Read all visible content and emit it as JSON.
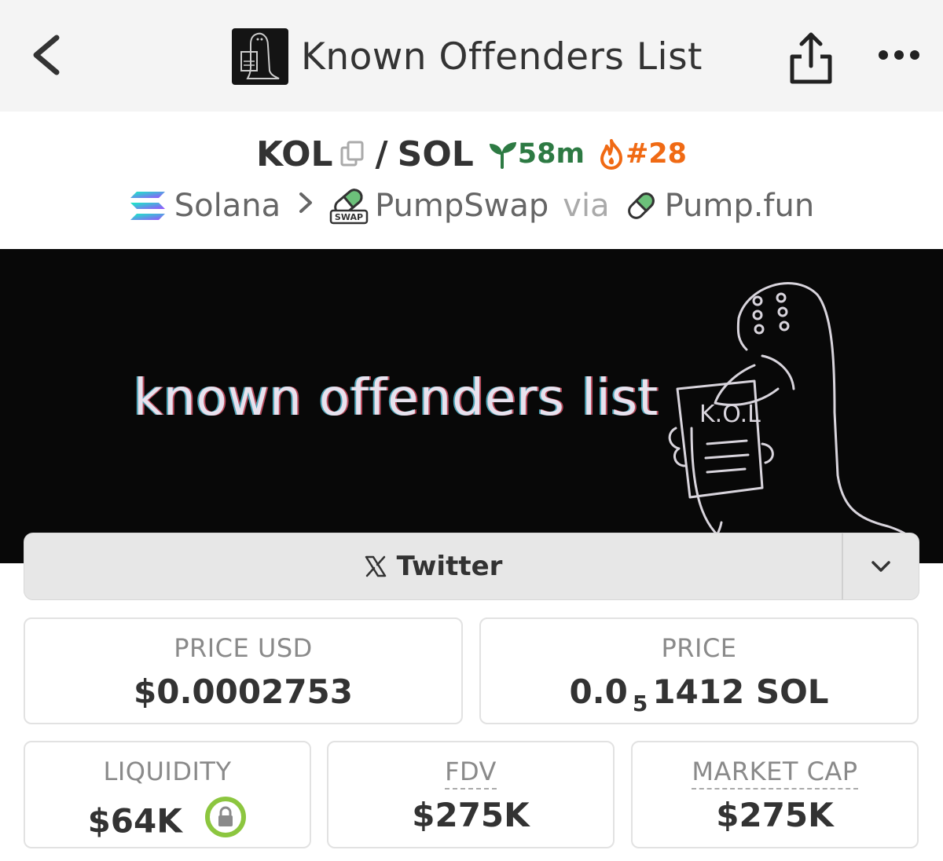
{
  "header": {
    "title": "Known Offenders List",
    "avatar_text": "K.O.L"
  },
  "pair": {
    "base": "KOL",
    "separator": "/",
    "quote": "SOL",
    "age": "58m",
    "rank": "#28"
  },
  "chain": {
    "network": "Solana",
    "dex": "PumpSwap",
    "via": "via",
    "launchpad": "Pump.fun",
    "swap_badge": "SWAP"
  },
  "banner": {
    "text": "known offenders list",
    "sign_text": "K.O.L"
  },
  "social": {
    "label": "Twitter"
  },
  "stats": {
    "price_usd_label": "PRICE USD",
    "price_usd_value": "$0.0002753",
    "price_label": "PRICE",
    "price_prefix": "0.0",
    "price_zeros": "5",
    "price_digits": "1412 SOL",
    "liquidity_label": "LIQUIDITY",
    "liquidity_value": "$64K",
    "fdv_label": "FDV",
    "fdv_value": "$275K",
    "mcap_label": "MARKET CAP",
    "mcap_value": "$275K"
  },
  "colors": {
    "age_green": "#2d7a43",
    "rank_orange": "#f06a14",
    "lock_green": "#8cc63f"
  }
}
